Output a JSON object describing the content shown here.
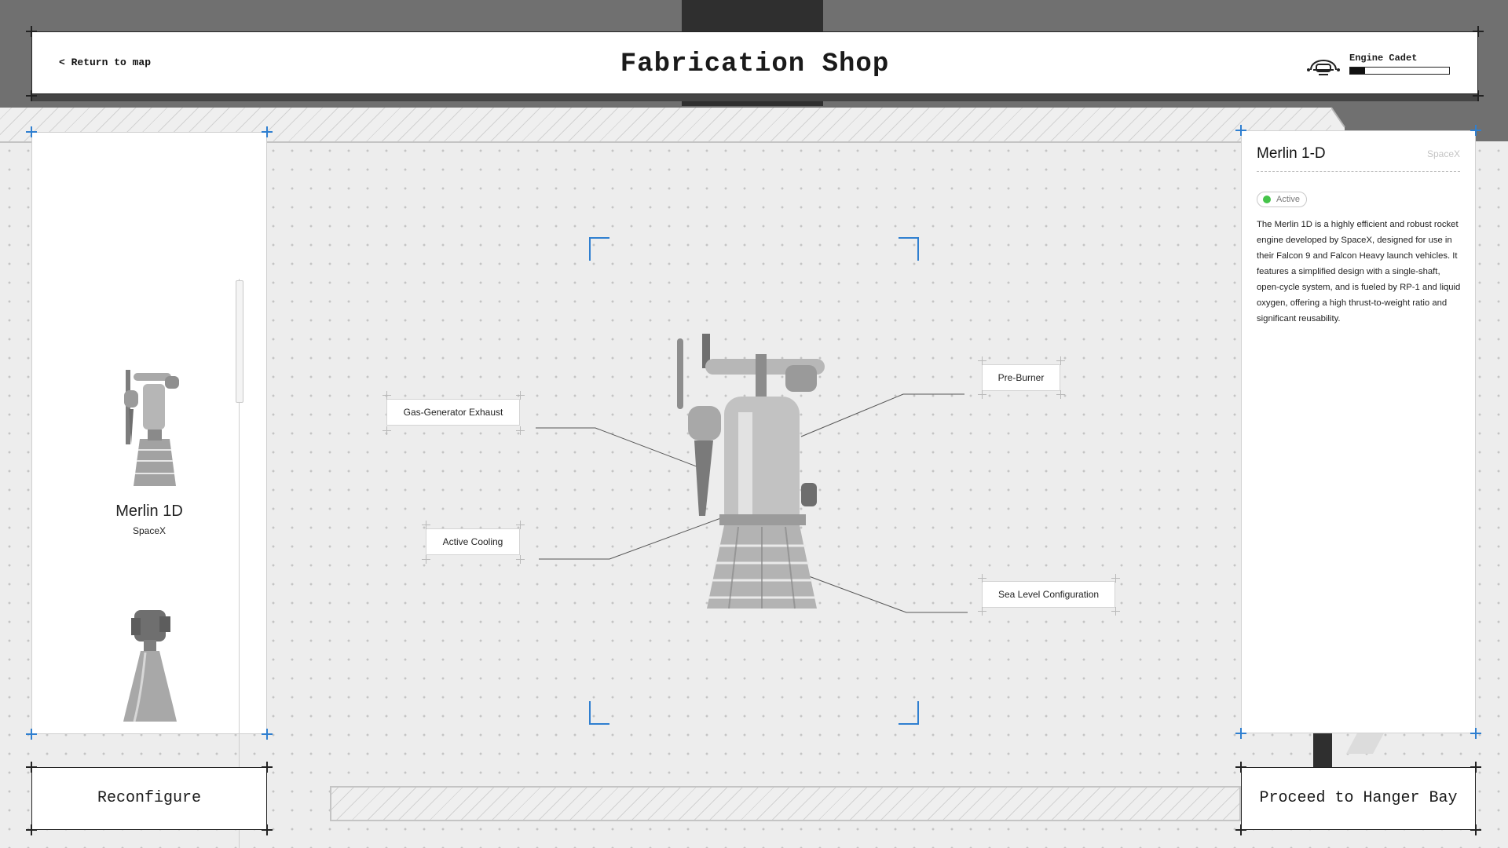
{
  "header": {
    "back_label": "<  Return to map",
    "title": "Fabrication Shop",
    "rank": {
      "label": "Engine Cadet",
      "progress": 0.15
    }
  },
  "engine_list": {
    "items": [
      {
        "name": "Merlin 1D",
        "maker": "SpaceX"
      },
      {
        "name": "",
        "maker": ""
      }
    ]
  },
  "viewer": {
    "callouts": [
      {
        "label": "Gas-Generator Exhaust"
      },
      {
        "label": "Active Cooling"
      },
      {
        "label": "Pre-Burner"
      },
      {
        "label": "Sea Level Configuration"
      }
    ]
  },
  "info": {
    "title": "Merlin 1-D",
    "maker": "SpaceX",
    "status": "Active",
    "status_color": "#45c44a",
    "description": "The Merlin 1D is a highly efficient and robust rocket engine developed by SpaceX, designed for use in their Falcon 9 and Falcon Heavy launch vehicles. It features a simplified design with a single-shaft, open-cycle system, and is fueled by RP-1 and liquid oxygen, offering a high thrust-to-weight ratio and significant reusability."
  },
  "actions": {
    "reconfigure_label": "Reconfigure",
    "proceed_label": "Proceed to Hanger Bay"
  },
  "colors": {
    "accent": "#2f7fd0",
    "ink": "#1a1a1a",
    "backdrop": "#707070"
  }
}
